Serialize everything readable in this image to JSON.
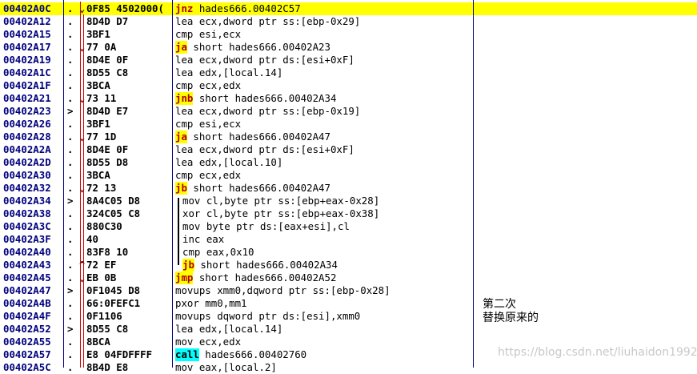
{
  "rows": [
    {
      "addr": "00402A0C",
      "mark": ". ⌄",
      "hex": "0F85 4502000(",
      "op": "jnz",
      "args": " hades666.00402C57",
      "hl": "y",
      "sel": true
    },
    {
      "addr": "00402A12",
      "mark": ".",
      "hex": "8D4D D7",
      "op": "",
      "args": "lea ecx,dword ptr ss:[ebp-0x29]"
    },
    {
      "addr": "00402A15",
      "mark": ".",
      "hex": "3BF1",
      "op": "",
      "args": "cmp esi,ecx"
    },
    {
      "addr": "00402A17",
      "mark": ". ⌄",
      "hex": "77 0A",
      "op": "ja",
      "args": " short hades666.00402A23",
      "hl": "y"
    },
    {
      "addr": "00402A19",
      "mark": ".",
      "hex": "8D4E 0F",
      "op": "",
      "args": "lea ecx,dword ptr ds:[esi+0xF]"
    },
    {
      "addr": "00402A1C",
      "mark": ".",
      "hex": "8D55 C8",
      "op": "",
      "args": "lea edx,[local.14]"
    },
    {
      "addr": "00402A1F",
      "mark": ".",
      "hex": "3BCA",
      "op": "",
      "args": "cmp ecx,edx"
    },
    {
      "addr": "00402A21",
      "mark": ". ⌄",
      "hex": "73 11",
      "op": "jnb",
      "args": " short hades666.00402A34",
      "hl": "y"
    },
    {
      "addr": "00402A23",
      "mark": ">",
      "hex": "8D4D E7",
      "op": "",
      "args": "lea ecx,dword ptr ss:[ebp-0x19]"
    },
    {
      "addr": "00402A26",
      "mark": ".",
      "hex": "3BF1",
      "op": "",
      "args": "cmp esi,ecx"
    },
    {
      "addr": "00402A28",
      "mark": ". ⌄",
      "hex": "77 1D",
      "op": "ja",
      "args": " short hades666.00402A47",
      "hl": "y"
    },
    {
      "addr": "00402A2A",
      "mark": ".",
      "hex": "8D4E 0F",
      "op": "",
      "args": "lea ecx,dword ptr ds:[esi+0xF]"
    },
    {
      "addr": "00402A2D",
      "mark": ".",
      "hex": "8D55 D8",
      "op": "",
      "args": "lea edx,[local.10]"
    },
    {
      "addr": "00402A30",
      "mark": ".",
      "hex": "3BCA",
      "op": "",
      "args": "cmp ecx,edx"
    },
    {
      "addr": "00402A32",
      "mark": ". ⌄",
      "hex": "72 13",
      "op": "jb",
      "args": " short hades666.00402A47",
      "hl": "y"
    },
    {
      "addr": "00402A34",
      "mark": ">",
      "hex": "8A4C05 D8",
      "op": "",
      "args": "mov cl,byte ptr ss:[ebp+eax-0x28]",
      "ind": true
    },
    {
      "addr": "00402A38",
      "mark": ".",
      "hex": "324C05 C8",
      "op": "",
      "args": "xor cl,byte ptr ss:[ebp+eax-0x38]",
      "ind": true
    },
    {
      "addr": "00402A3C",
      "mark": ".",
      "hex": "880C30",
      "op": "",
      "args": "mov byte ptr ds:[eax+esi],cl",
      "ind": true
    },
    {
      "addr": "00402A3F",
      "mark": ".",
      "hex": "40",
      "op": "",
      "args": "inc eax",
      "ind": true
    },
    {
      "addr": "00402A40",
      "mark": ".",
      "hex": "83F8 10",
      "op": "",
      "args": "cmp eax,0x10",
      "ind": true
    },
    {
      "addr": "00402A43",
      "mark": ". ^",
      "hex": "72 EF",
      "op": "jb",
      "args": " short hades666.00402A34",
      "hl": "y",
      "ind": true
    },
    {
      "addr": "00402A45",
      "mark": ". ⌄",
      "hex": "EB 0B",
      "op": "jmp",
      "args": " short hades666.00402A52",
      "hl": "y"
    },
    {
      "addr": "00402A47",
      "mark": ">",
      "hex": "0F1045 D8",
      "op": "",
      "args": "movups xmm0,dqword ptr ss:[ebp-0x28]"
    },
    {
      "addr": "00402A4B",
      "mark": ".",
      "hex": "66:0FEFC1",
      "op": "",
      "args": "pxor mm0,mm1"
    },
    {
      "addr": "00402A4F",
      "mark": ".",
      "hex": "0F1106",
      "op": "",
      "args": "movups dqword ptr ds:[esi],xmm0"
    },
    {
      "addr": "00402A52",
      "mark": ">",
      "hex": "8D55 C8",
      "op": "",
      "args": "lea edx,[local.14]"
    },
    {
      "addr": "00402A55",
      "mark": ".",
      "hex": "8BCA",
      "op": "",
      "args": "mov ecx,edx"
    },
    {
      "addr": "00402A57",
      "mark": ".",
      "hex": "E8 04FDFFFF",
      "op": "call",
      "args": " hades666.00402760",
      "hl": "c"
    },
    {
      "addr": "00402A5C",
      "mark": ".",
      "hex": "8B4D E8",
      "op": "",
      "args": "mov eax,[local.2]"
    }
  ],
  "note": {
    "line1": "第二次",
    "line2": "替换原来的"
  },
  "watermark": "https://blog.csdn.net/liuhaidon1992"
}
